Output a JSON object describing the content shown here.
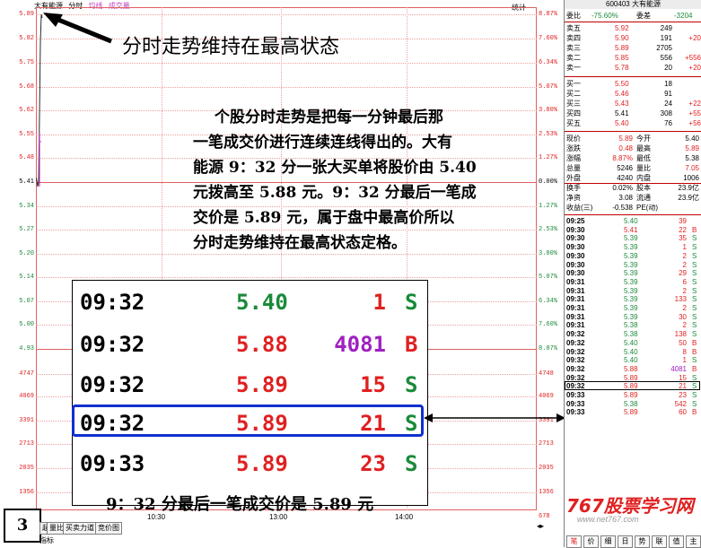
{
  "header": {
    "stock_name": "大有能源",
    "mode": "分时",
    "tab_avg": "均线",
    "tab_volume": "成交量",
    "right_label": "统计"
  },
  "price_ticks_left": [
    "5.89",
    "5.82",
    "5.75",
    "5.68",
    "5.62",
    "5.55",
    "5.48",
    "5.41",
    "5.34",
    "5.27",
    "5.20",
    "5.14",
    "5.07",
    "5.00",
    "4.93",
    "4747",
    "4069",
    "3391",
    "2713",
    "2035",
    "1356",
    "678"
  ],
  "pct_ticks_right": [
    "8.87%",
    "7.60%",
    "6.34%",
    "5.07%",
    "3.80%",
    "2.53%",
    "1.27%",
    "0.00%",
    "1.27%",
    "2.53%",
    "3.80%",
    "5.07%",
    "6.34%",
    "7.60%",
    "8.87%",
    "4748",
    "4069",
    "3391",
    "2713",
    "2035",
    "1356",
    "678"
  ],
  "time_ticks": [
    "10:30",
    "13:00",
    "14:00"
  ],
  "annotations": {
    "arrow_title": "分时走势维持在最高状态",
    "explanation_lines": [
      "个股分时走势是把每一分钟最后那",
      "一笔成交价进行连续连线得出的。大有",
      "能源 9：32 分一张大买单将股价由 5.40",
      "元拨高至 5.88 元。9：32 分最后一笔成",
      "交价是 5.89 元，属于盘中最高价所以",
      "分时走势维持在最高状态定格。"
    ],
    "bottom_caption": "9：32 分最后一笔成交价是 5.89 元",
    "page_number": "3"
  },
  "zoom_trades": [
    {
      "time": "09:32",
      "price": "5.40",
      "vol": "1",
      "side": "S"
    },
    {
      "time": "09:32",
      "price": "5.88",
      "vol": "4081",
      "side": "B"
    },
    {
      "time": "09:32",
      "price": "5.89",
      "vol": "15",
      "side": "S"
    },
    {
      "time": "09:32",
      "price": "5.89",
      "vol": "21",
      "side": "S"
    },
    {
      "time": "09:33",
      "price": "5.89",
      "vol": "23",
      "side": "S"
    }
  ],
  "bottom_tabs": [
    "超",
    "量比",
    "买卖力道",
    "竞价图"
  ],
  "bottom_tab_left": "指标",
  "info": {
    "code_title": "600403 大有能源",
    "weibi_label": "委比",
    "weibi_val": "-75.60%",
    "weicha_label": "委差",
    "weicha_val": "-3204",
    "sell": [
      {
        "label": "卖五",
        "price": "5.92",
        "vol": "249",
        "chg": ""
      },
      {
        "label": "卖四",
        "price": "5.90",
        "vol": "191",
        "chg": "+20"
      },
      {
        "label": "卖三",
        "price": "5.89",
        "vol": "2705",
        "chg": ""
      },
      {
        "label": "卖二",
        "price": "5.85",
        "vol": "556",
        "chg": "+556"
      },
      {
        "label": "卖一",
        "price": "5.78",
        "vol": "20",
        "chg": "+20"
      }
    ],
    "buy": [
      {
        "label": "买一",
        "price": "5.50",
        "vol": "18",
        "chg": ""
      },
      {
        "label": "买二",
        "price": "5.46",
        "vol": "91",
        "chg": ""
      },
      {
        "label": "买三",
        "price": "5.43",
        "vol": "24",
        "chg": "+22"
      },
      {
        "label": "买四",
        "price": "5.41",
        "vol": "308",
        "chg": "+55"
      },
      {
        "label": "买五",
        "price": "5.40",
        "vol": "76",
        "chg": "+56"
      }
    ],
    "stats": [
      {
        "l1": "现价",
        "v1": "5.89",
        "l2": "今开",
        "v2": "5.40"
      },
      {
        "l1": "涨跌",
        "v1": "0.48",
        "l2": "最高",
        "v2": "5.89"
      },
      {
        "l1": "涨幅",
        "v1": "8.87%",
        "l2": "最低",
        "v2": "5.38"
      },
      {
        "l1": "总量",
        "v1": "5246",
        "l2": "量比",
        "v2": "7.05"
      },
      {
        "l1": "外盘",
        "v1": "4240",
        "l2": "内盘",
        "v2": "1006"
      },
      {
        "l1": "换手",
        "v1": "0.02%",
        "l2": "股本",
        "v2": "23.9亿"
      },
      {
        "l1": "净资",
        "v1": "3.08",
        "l2": "流通",
        "v2": "23.9亿"
      },
      {
        "l1": "收益(三)",
        "v1": "-0.538",
        "l2": "PE(动)",
        "v2": ""
      }
    ],
    "ticks": [
      {
        "t": "09:25",
        "p": "5.40",
        "v": "39",
        "s": ""
      },
      {
        "t": "09:30",
        "p": "5.41",
        "v": "22",
        "s": "B"
      },
      {
        "t": "09:30",
        "p": "5.39",
        "v": "35",
        "s": "S"
      },
      {
        "t": "09:30",
        "p": "5.39",
        "v": "1",
        "s": "S"
      },
      {
        "t": "09:30",
        "p": "5.39",
        "v": "2",
        "s": "S"
      },
      {
        "t": "09:30",
        "p": "5.39",
        "v": "2",
        "s": "S"
      },
      {
        "t": "09:30",
        "p": "5.39",
        "v": "29",
        "s": "S"
      },
      {
        "t": "09:31",
        "p": "5.39",
        "v": "6",
        "s": "S"
      },
      {
        "t": "09:31",
        "p": "5.39",
        "v": "2",
        "s": "S"
      },
      {
        "t": "09:31",
        "p": "5.39",
        "v": "133",
        "s": "S"
      },
      {
        "t": "09:31",
        "p": "5.39",
        "v": "2",
        "s": "S"
      },
      {
        "t": "09:31",
        "p": "5.39",
        "v": "30",
        "s": "S"
      },
      {
        "t": "09:31",
        "p": "5.38",
        "v": "2",
        "s": "S"
      },
      {
        "t": "09:32",
        "p": "5.38",
        "v": "138",
        "s": "S"
      },
      {
        "t": "09:32",
        "p": "5.40",
        "v": "50",
        "s": "B"
      },
      {
        "t": "09:32",
        "p": "5.40",
        "v": "8",
        "s": "B"
      },
      {
        "t": "09:32",
        "p": "5.40",
        "v": "1",
        "s": "S"
      },
      {
        "t": "09:32",
        "p": "5.88",
        "v": "4081",
        "s": "B"
      },
      {
        "t": "09:32",
        "p": "5.89",
        "v": "15",
        "s": "S"
      },
      {
        "t": "09:32",
        "p": "5.89",
        "v": "21",
        "s": "S"
      },
      {
        "t": "09:33",
        "p": "5.89",
        "v": "23",
        "s": "S"
      },
      {
        "t": "09:33",
        "p": "5.38",
        "v": "542",
        "s": "S"
      },
      {
        "t": "09:33",
        "p": "5.89",
        "v": "60",
        "s": "B"
      }
    ],
    "watermark": "767股票学习网",
    "watermark_url": "www.net767.com",
    "bottom_tabs": [
      "笔",
      "价",
      "细",
      "日",
      "势",
      "联",
      "值",
      "主"
    ]
  }
}
